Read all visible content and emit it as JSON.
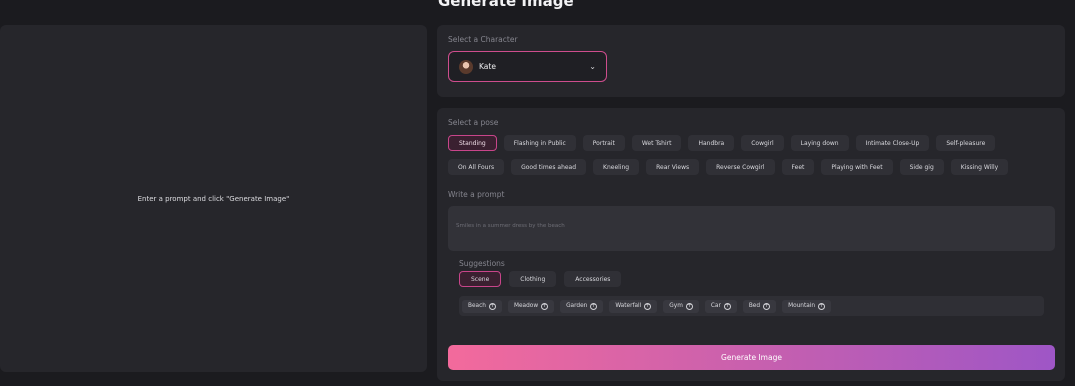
{
  "header": {
    "title": "Generate Image"
  },
  "preview": {
    "hint": "Enter a prompt and click \"Generate Image\""
  },
  "character": {
    "label": "Select a Character",
    "selected": "Kate",
    "chevron_icon": "chevron-down-icon"
  },
  "pose": {
    "label": "Select a pose",
    "active": "Standing",
    "row1": [
      "Standing",
      "Flashing in Public",
      "Portrait",
      "Wet Tshirt",
      "Handbra",
      "Cowgirl",
      "Laying down",
      "Intimate Close-Up",
      "Self-pleasure"
    ],
    "row2": [
      "On All Fours",
      "Good times ahead",
      "Kneeling",
      "Rear Views",
      "Reverse Cowgirl",
      "Feet",
      "Playing with Feet",
      "Side gig",
      "Kissing Willy"
    ]
  },
  "prompt": {
    "label": "Write a prompt",
    "placeholder": "Smiles in a summer dress by the beach"
  },
  "suggestions": {
    "label": "Suggestions",
    "tabs": [
      "Scene",
      "Clothing",
      "Accessories"
    ],
    "active_tab": "Scene",
    "tags": [
      "Beach",
      "Meadow",
      "Garden",
      "Waterfall",
      "Gym",
      "Car",
      "Bed",
      "Mountain"
    ],
    "tag_icon": "plus-circle-icon"
  },
  "actions": {
    "generate_label": "Generate Image"
  },
  "colors": {
    "accent": "#ce4d8d",
    "gradient_start": "#f36a9c",
    "gradient_end": "#9e56c6",
    "panel": "#26262b",
    "background": "#1b1b1f"
  }
}
